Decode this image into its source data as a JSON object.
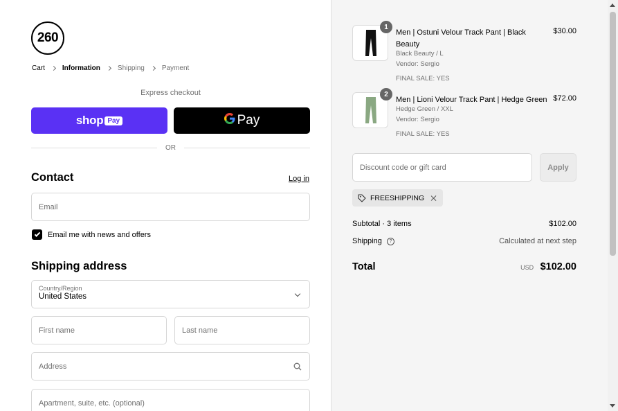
{
  "brand": {
    "logo_text": "260"
  },
  "breadcrumb": [
    {
      "label": "Cart",
      "state": "link"
    },
    {
      "label": "Information",
      "state": "current"
    },
    {
      "label": "Shipping",
      "state": "upcoming"
    },
    {
      "label": "Payment",
      "state": "upcoming"
    }
  ],
  "express": {
    "label": "Express checkout",
    "shop_pay": {
      "shop": "shop",
      "pay": "Pay"
    },
    "google_pay": {
      "g": "G",
      "pay": "Pay"
    },
    "divider": "OR"
  },
  "contact": {
    "title": "Contact",
    "login_label": "Log in",
    "email_placeholder": "Email",
    "newsletter_label": "Email me with news and offers",
    "newsletter_checked": true
  },
  "shipping": {
    "title": "Shipping address",
    "country_label": "Country/Region",
    "country_value": "United States",
    "first_name_placeholder": "First name",
    "last_name_placeholder": "Last name",
    "address_placeholder": "Address",
    "apartment_placeholder": "Apartment, suite, etc. (optional)"
  },
  "order": {
    "items": [
      {
        "quantity": "1",
        "name": "Men | Ostuni Velour Track Pant | Black Beauty",
        "variant": "Black Beauty / L",
        "vendor": "Vendor: Sergio",
        "final_sale": "FINAL SALE: YES",
        "price": "$30.00",
        "thumb_color": "#111111"
      },
      {
        "quantity": "2",
        "name": "Men | Lioni Velour Track Pant | Hedge Green",
        "variant": "Hedge Green / XXL",
        "vendor": "Vendor: Sergio",
        "final_sale": "FINAL SALE: YES",
        "price": "$72.00",
        "thumb_color": "#8aa882"
      }
    ],
    "discount_placeholder": "Discount code or gift card",
    "apply_label": "Apply",
    "applied_code": "FREESHIPPING",
    "subtotal_label": "Subtotal · 3 items",
    "subtotal_value": "$102.00",
    "shipping_label": "Shipping",
    "shipping_value": "Calculated at next step",
    "total_label": "Total",
    "total_currency": "USD",
    "total_value": "$102.00"
  },
  "colors": {
    "shop_pay": "#5a31f4",
    "google_pay": "#000000",
    "summary_bg": "#f5f5f5"
  }
}
